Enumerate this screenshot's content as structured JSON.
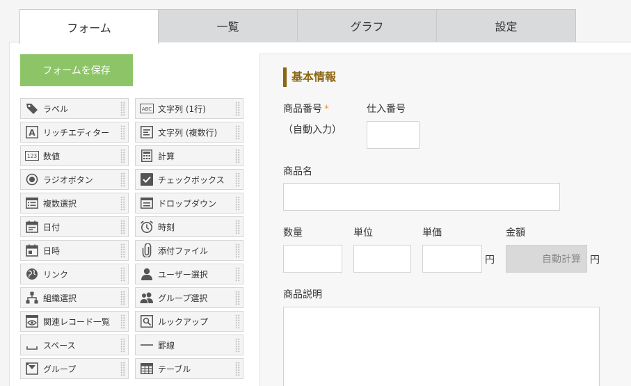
{
  "tabs": [
    {
      "label": "フォーム",
      "active": true
    },
    {
      "label": "一覧",
      "active": false
    },
    {
      "label": "グラフ",
      "active": false
    },
    {
      "label": "設定",
      "active": false
    }
  ],
  "save_button": {
    "label": "フォームを保存",
    "color": "#8dc468"
  },
  "palette": [
    {
      "label": "ラベル",
      "icon": "tag-icon"
    },
    {
      "label": "文字列 (1行)",
      "icon": "abc-text-icon"
    },
    {
      "label": "リッチエディター",
      "icon": "rich-editor-icon"
    },
    {
      "label": "文字列 (複数行)",
      "icon": "multiline-text-icon"
    },
    {
      "label": "数値",
      "icon": "number-123-icon"
    },
    {
      "label": "計算",
      "icon": "calculator-icon"
    },
    {
      "label": "ラジオボタン",
      "icon": "radio-icon"
    },
    {
      "label": "チェックボックス",
      "icon": "checkbox-icon"
    },
    {
      "label": "複数選択",
      "icon": "multi-select-icon"
    },
    {
      "label": "ドロップダウン",
      "icon": "dropdown-icon"
    },
    {
      "label": "日付",
      "icon": "date-icon"
    },
    {
      "label": "時刻",
      "icon": "alarm-clock-icon"
    },
    {
      "label": "日時",
      "icon": "datetime-icon"
    },
    {
      "label": "添付ファイル",
      "icon": "paperclip-icon"
    },
    {
      "label": "リンク",
      "icon": "globe-icon"
    },
    {
      "label": "ユーザー選択",
      "icon": "user-icon"
    },
    {
      "label": "組織選択",
      "icon": "org-tree-icon"
    },
    {
      "label": "グループ選択",
      "icon": "group-users-icon"
    },
    {
      "label": "関連レコード一覧",
      "icon": "related-records-icon"
    },
    {
      "label": "ルックアップ",
      "icon": "lookup-icon"
    },
    {
      "label": "スペース",
      "icon": "space-icon"
    },
    {
      "label": "罫線",
      "icon": "horizontal-rule-icon"
    },
    {
      "label": "グループ",
      "icon": "group-folder-icon"
    },
    {
      "label": "テーブル",
      "icon": "table-icon"
    }
  ],
  "form": {
    "section_title": "基本情報",
    "section_color": "#8b6513",
    "product_number_label": "商品番号",
    "required_mark": "*",
    "auto_input_text": "（自動入力）",
    "purchase_number_label": "仕入番号",
    "product_name_label": "商品名",
    "quantity_label": "数量",
    "unit_label": "単位",
    "unit_price_label": "単価",
    "amount_label": "金額",
    "yen": "円",
    "auto_calc_text": "自動計算",
    "description_label": "商品説明"
  }
}
